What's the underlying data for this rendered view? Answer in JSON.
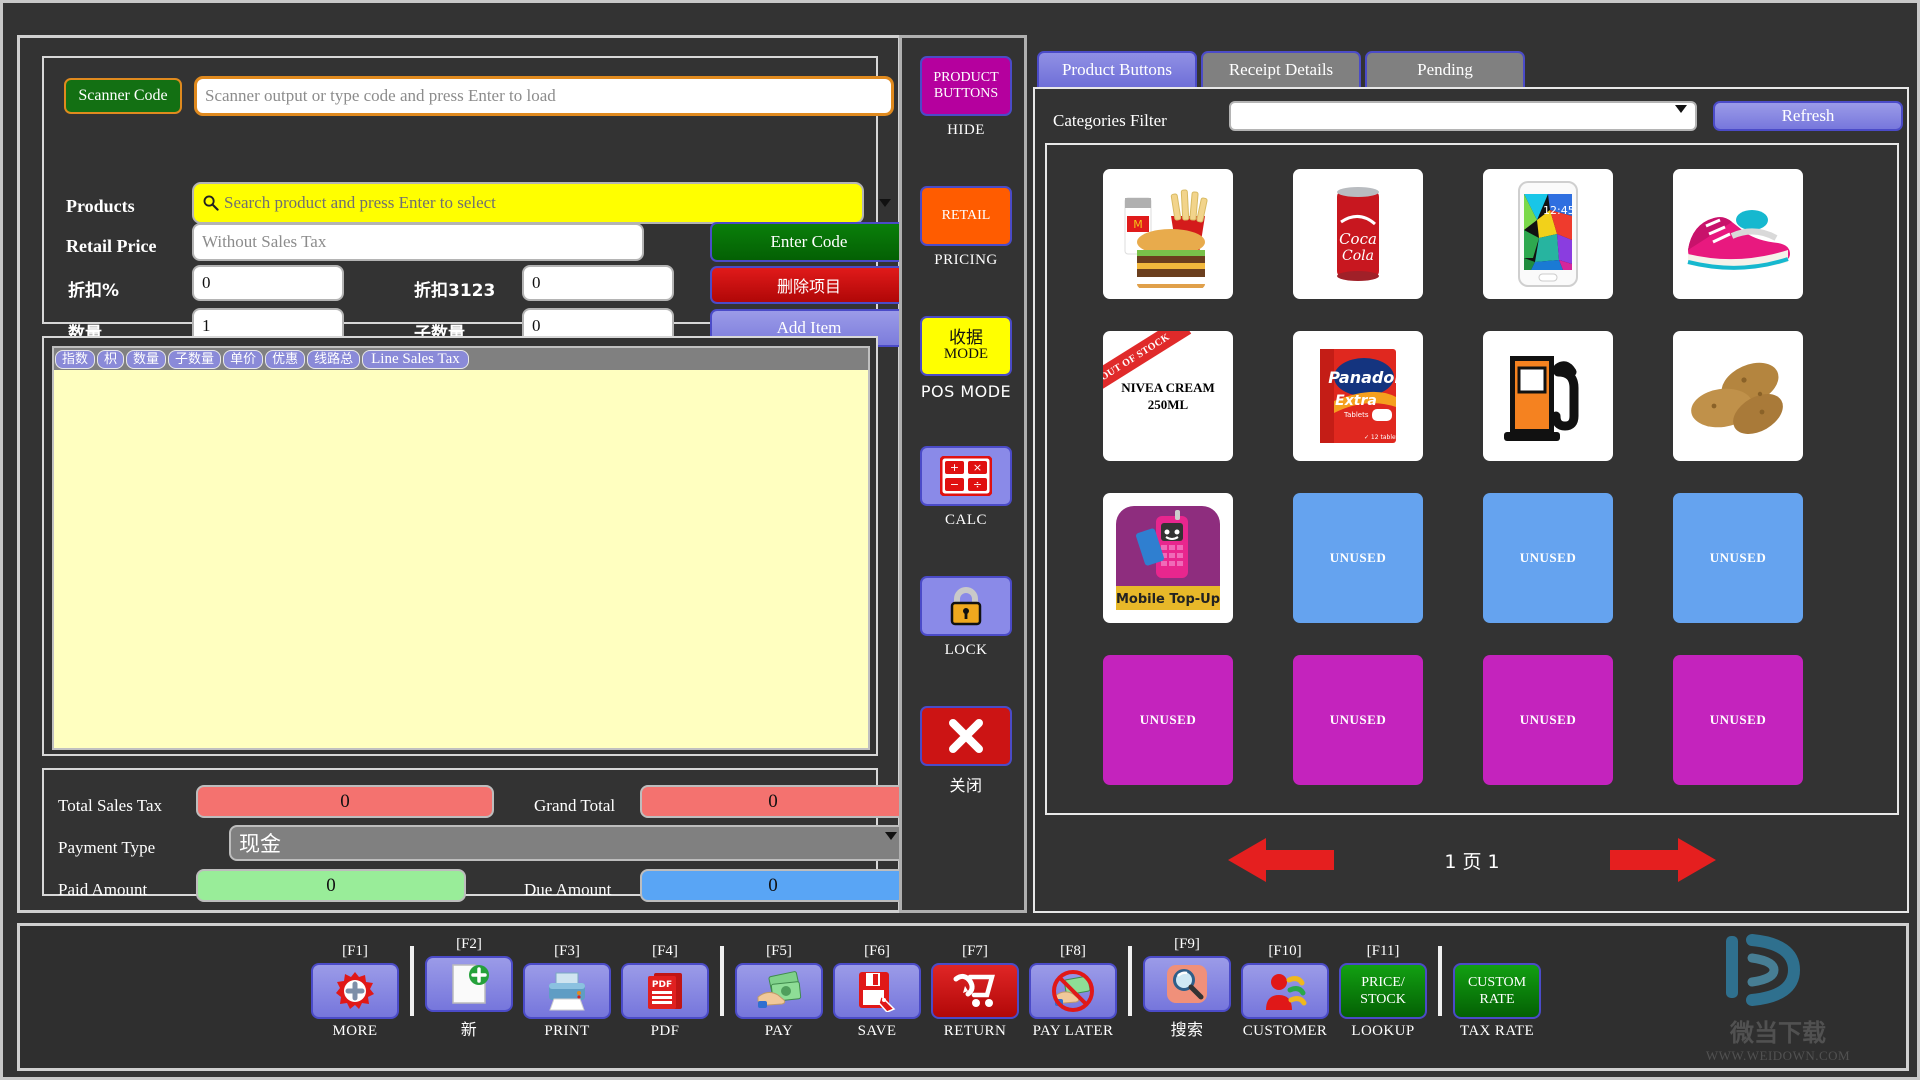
{
  "entry": {
    "scanner_code_button": "Scanner Code",
    "scanner_placeholder": "Scanner output or type code and press Enter to load",
    "scanner_value": "",
    "products_label": "Products",
    "products_placeholder": "Search product and press Enter to select",
    "products_value": "",
    "retail_price_label": "Retail Price",
    "retail_price_placeholder": "Without Sales Tax",
    "retail_price_value": "",
    "discount_pct_label": "折扣%",
    "discount_pct_value": "0",
    "discount_amt_label": "折扣3123",
    "discount_amt_value": "0",
    "qty_label": "数量",
    "qty_value": "1",
    "subqty_label": "子数量",
    "subqty_value": "0",
    "enter_code_button": "Enter Code",
    "delete_item_button": "删除项目",
    "add_item_button": "Add Item"
  },
  "items_grid": {
    "columns": [
      "指数",
      "枳",
      "数量",
      "子数量",
      "单价",
      "优惠",
      "线路总",
      "Line Sales Tax"
    ],
    "rows": []
  },
  "totals": {
    "total_sales_tax_label": "Total Sales Tax",
    "total_sales_tax_value": "0",
    "grand_total_label": "Grand Total",
    "grand_total_value": "0",
    "payment_type_label": "Payment Type",
    "payment_type_value": "现金",
    "paid_amount_label": "Paid Amount",
    "paid_amount_value": "0",
    "due_amount_label": "Due Amount",
    "due_amount_value": "0"
  },
  "side_toolbar": [
    {
      "button_text": "PRODUCT BUTTONS",
      "caption": "HIDE",
      "color": "#b5009e",
      "icon": "product-buttons-icon",
      "cn": false
    },
    {
      "button_text": "RETAIL",
      "caption": "PRICING",
      "color": "#ff5c00",
      "icon": "retail-pricing-icon",
      "cn": false
    },
    {
      "button_text": "收据 MODE",
      "caption": "POS MODE",
      "color": "#ffff00",
      "icon": "pos-mode-icon",
      "cn": true
    },
    {
      "button_text": "",
      "caption": "CALC",
      "color": "#8a8ae8",
      "icon": "calculator-icon",
      "cn": false
    },
    {
      "button_text": "",
      "caption": "LOCK",
      "color": "#8a8ae8",
      "icon": "lock-icon",
      "cn": false
    },
    {
      "button_text": "",
      "caption": "关闭",
      "color": "#cc1414",
      "icon": "close-x-icon",
      "cn": true
    }
  ],
  "side_toolbar_labels": {
    "pos_mode_line1": "收据",
    "pos_mode_line2": "MODE"
  },
  "right_panel": {
    "tabs": [
      {
        "label": "Product Buttons",
        "active": true
      },
      {
        "label": "Receipt Details",
        "active": false
      },
      {
        "label": "Pending",
        "active": false
      }
    ],
    "categories_filter_label": "Categories Filter",
    "categories_filter_value": "",
    "refresh_button": "Refresh",
    "page_text": "1 页 1",
    "prev_page_icon": "arrow-left-icon",
    "next_page_icon": "arrow-right-icon",
    "tiles": [
      {
        "kind": "image",
        "icon": "burger-meal-icon",
        "name": ""
      },
      {
        "kind": "image",
        "icon": "coke-can-icon",
        "name": ""
      },
      {
        "kind": "image",
        "icon": "smartphone-icon",
        "name": ""
      },
      {
        "kind": "image",
        "icon": "sneaker-icon",
        "name": ""
      },
      {
        "kind": "text",
        "icon": "nivea-cream-icon",
        "name": "NIVEA CREAM 250ML",
        "ribbon": "OUT OF STOCK"
      },
      {
        "kind": "image",
        "icon": "panadol-box-icon",
        "name": ""
      },
      {
        "kind": "image",
        "icon": "fuel-pump-icon",
        "name": ""
      },
      {
        "kind": "image",
        "icon": "potatoes-icon",
        "name": ""
      },
      {
        "kind": "image",
        "icon": "mobile-topup-icon",
        "name": "Mobile Top-Up"
      },
      {
        "kind": "unused-blue",
        "icon": "unused-tile-icon",
        "name": "UNUSED"
      },
      {
        "kind": "unused-blue",
        "icon": "unused-tile-icon",
        "name": "UNUSED"
      },
      {
        "kind": "unused-blue",
        "icon": "unused-tile-icon",
        "name": "UNUSED"
      },
      {
        "kind": "unused-pink",
        "icon": "unused-tile-icon",
        "name": "UNUSED"
      },
      {
        "kind": "unused-pink",
        "icon": "unused-tile-icon",
        "name": "UNUSED"
      },
      {
        "kind": "unused-pink",
        "icon": "unused-tile-icon",
        "name": "UNUSED"
      },
      {
        "kind": "unused-pink",
        "icon": "unused-tile-icon",
        "name": "UNUSED"
      }
    ]
  },
  "function_bar": {
    "keys": [
      {
        "key": "[F1]",
        "caption": "MORE",
        "icon": "gear-plus-icon",
        "style": "purple",
        "text": "",
        "cn": false,
        "divider_after": true
      },
      {
        "key": "[F2]",
        "caption": "新",
        "icon": "new-doc-icon",
        "style": "purple",
        "text": "",
        "cn": true,
        "divider_after": false
      },
      {
        "key": "[F3]",
        "caption": "PRINT",
        "icon": "printer-icon",
        "style": "purple",
        "text": "",
        "cn": false,
        "divider_after": false
      },
      {
        "key": "[F4]",
        "caption": "PDF",
        "icon": "pdf-icon",
        "style": "purple",
        "text": "",
        "cn": false,
        "divider_after": true
      },
      {
        "key": "[F5]",
        "caption": "PAY",
        "icon": "cash-hand-icon",
        "style": "purple",
        "text": "",
        "cn": false,
        "divider_after": false
      },
      {
        "key": "[F6]",
        "caption": "SAVE",
        "icon": "floppy-tag-icon",
        "style": "purple",
        "text": "",
        "cn": false,
        "divider_after": false
      },
      {
        "key": "[F7]",
        "caption": "RETURN",
        "icon": "return-cart-icon",
        "style": "red",
        "text": "",
        "cn": false,
        "divider_after": false
      },
      {
        "key": "[F8]",
        "caption": "PAY LATER",
        "icon": "no-cash-icon",
        "style": "purple",
        "text": "",
        "cn": false,
        "divider_after": true
      },
      {
        "key": "[F9]",
        "caption": "搜索",
        "icon": "search-icon",
        "style": "purple",
        "text": "",
        "cn": true,
        "divider_after": false
      },
      {
        "key": "[F10]",
        "caption": "CUSTOMER",
        "icon": "customer-icon",
        "style": "purple",
        "text": "",
        "cn": false,
        "divider_after": false
      },
      {
        "key": "[F11]",
        "caption": "LOOKUP",
        "icon": "price-stock-icon",
        "style": "green",
        "text": "PRICE/ STOCK",
        "cn": false,
        "divider_after": true
      },
      {
        "key": "",
        "caption": "TAX RATE",
        "icon": "custom-rate-icon",
        "style": "green",
        "text": "CUSTOM RATE",
        "cn": false,
        "divider_after": false
      }
    ]
  },
  "watermark": {
    "logo": "D",
    "chinese": "微当下载",
    "url": "WWW.WEIDOWN.COM"
  }
}
